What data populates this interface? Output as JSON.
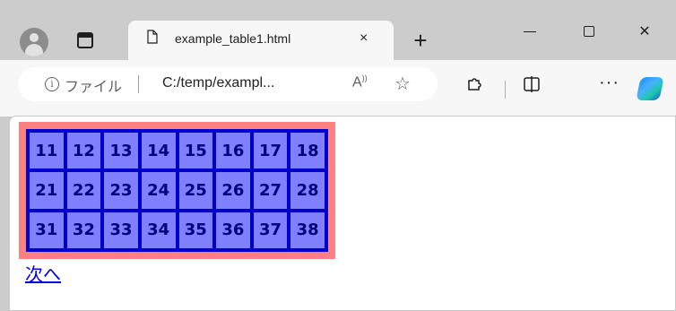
{
  "browser": {
    "tab": {
      "title": "example_table1.html",
      "close": "×"
    },
    "new_tab": "+",
    "window": {
      "close": "✕"
    }
  },
  "addressbar": {
    "info": "i",
    "file_label": "ファイル",
    "url": "C:/temp/exampl..."
  },
  "page": {
    "table": {
      "rows": [
        [
          "11",
          "12",
          "13",
          "14",
          "15",
          "16",
          "17",
          "18"
        ],
        [
          "21",
          "22",
          "23",
          "24",
          "25",
          "26",
          "27",
          "28"
        ],
        [
          "31",
          "32",
          "33",
          "34",
          "35",
          "36",
          "37",
          "38"
        ]
      ],
      "colors": {
        "outer": "#ff8080",
        "cell": "#8080ff",
        "border": "#0000cc",
        "text": "#000080"
      }
    },
    "next_link": "次へ"
  }
}
